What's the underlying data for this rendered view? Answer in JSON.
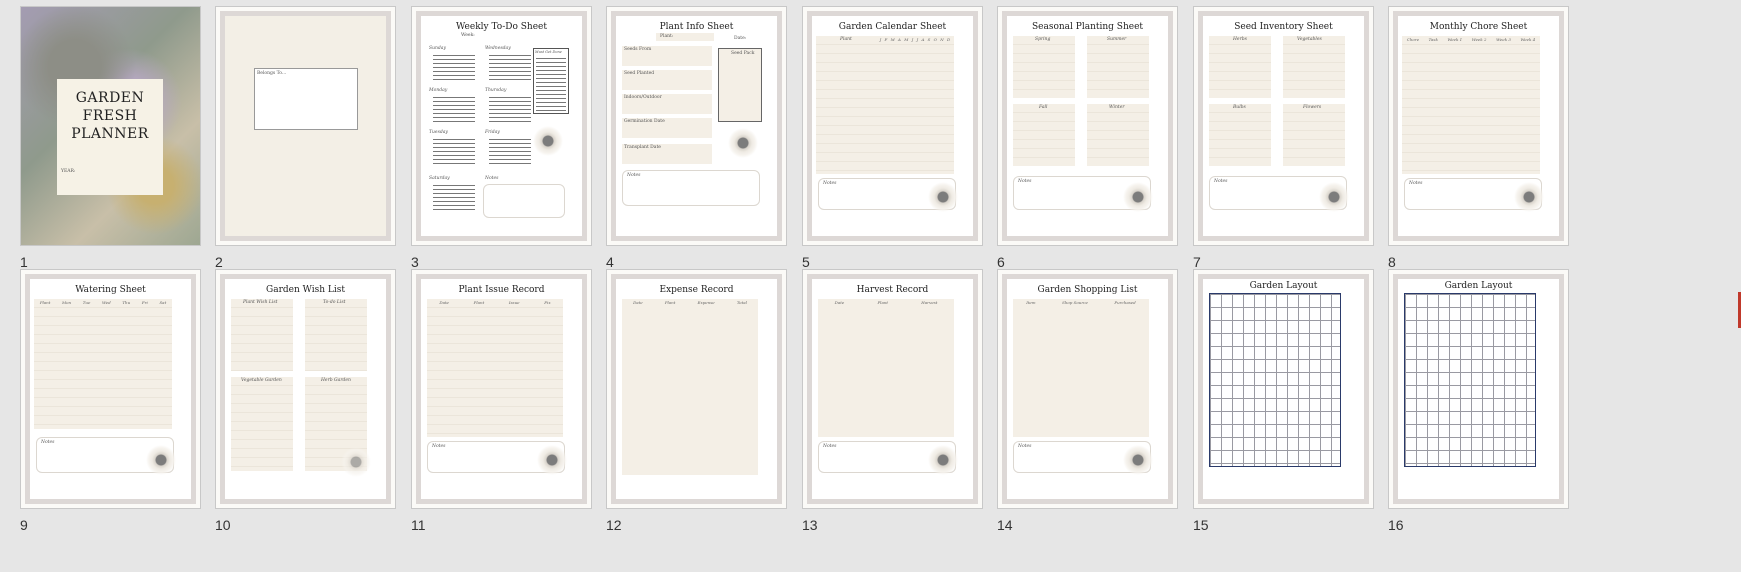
{
  "slides": [
    {
      "number": "1",
      "cover_title": "GARDEN FRESH PLANNER",
      "year_label": "YEAR:"
    },
    {
      "number": "2",
      "belongs_label": "Belongs To..."
    },
    {
      "number": "3",
      "title": "Weekly To-Do Sheet",
      "week_label": "Week:",
      "days": [
        "Sunday",
        "Monday",
        "Tuesday",
        "Saturday",
        "Wednesday",
        "Thursday",
        "Friday"
      ],
      "must_label": "Must Get Done",
      "notes_label": "Notes"
    },
    {
      "number": "4",
      "title": "Plant Info Sheet",
      "plant_label": "Plant:",
      "date_label": "Date:",
      "fields": [
        "Seeds From",
        "Seed Planted",
        "Indoors/Outdoor",
        "Germination Date",
        "Transplant Date"
      ],
      "seed_pack_label": "Seed Pack",
      "notes_label": "Notes"
    },
    {
      "number": "5",
      "title": "Garden Calendar Sheet",
      "plant_col": "Plant",
      "months": [
        "J",
        "F",
        "M",
        "A",
        "M",
        "J",
        "J",
        "A",
        "S",
        "O",
        "N",
        "D"
      ],
      "notes_label": "Notes"
    },
    {
      "number": "6",
      "title": "Seasonal Planting Sheet",
      "seasons": [
        "Spring",
        "Summer",
        "Fall",
        "Winter"
      ],
      "notes_label": "Notes"
    },
    {
      "number": "7",
      "title": "Seed Inventory Sheet",
      "groups": [
        "Herbs",
        "Vegetables",
        "Bulbs",
        "Flowers"
      ],
      "notes_label": "Notes"
    },
    {
      "number": "8",
      "title": "Monthly Chore Sheet",
      "cols": [
        "Chore",
        "Task",
        "Week 1",
        "Week 2",
        "Week 3",
        "Week 4"
      ],
      "notes_label": "Notes"
    },
    {
      "number": "9",
      "title": "Watering Sheet",
      "cols": [
        "Plant",
        "Mon",
        "Tue",
        "Wed",
        "Thu",
        "Fri",
        "Sat"
      ],
      "notes_label": "Notes"
    },
    {
      "number": "10",
      "title": "Garden Wish List",
      "sections": [
        "Plant Wish List",
        "To-do List",
        "Vegetable Garden",
        "Herb Garden"
      ]
    },
    {
      "number": "11",
      "title": "Plant Issue Record",
      "cols": [
        "Date",
        "Plant",
        "Issue",
        "Fix"
      ],
      "notes_label": "Notes"
    },
    {
      "number": "12",
      "title": "Expense Record",
      "cols": [
        "Date",
        "Plant",
        "Expense",
        "Total"
      ]
    },
    {
      "number": "13",
      "title": "Harvest Record",
      "cols": [
        "Date",
        "Plant",
        "Harvest"
      ],
      "notes_label": "Notes"
    },
    {
      "number": "14",
      "title": "Garden Shopping List",
      "cols": [
        "Item",
        "Shop Source",
        "Purchased"
      ],
      "notes_label": "Notes"
    },
    {
      "number": "15",
      "title": "Garden Layout"
    },
    {
      "number": "16",
      "title": "Garden Layout"
    }
  ]
}
